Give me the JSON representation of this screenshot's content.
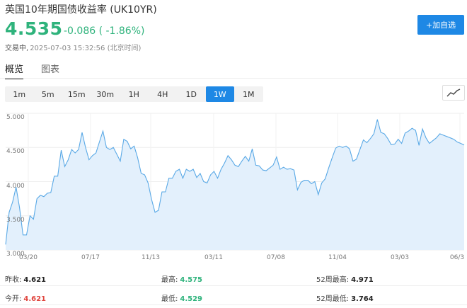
{
  "header": {
    "title": "英国10年期国债收益率 (UK10YR)",
    "price": "4.535",
    "change": "-0.086 ( -1.86%)",
    "status": "交易中,",
    "timestamp": "2025-07-03 15:32:56 (北京时间)",
    "add_watchlist": "+加自选"
  },
  "tabs": [
    {
      "label": "概览",
      "active": true
    },
    {
      "label": "图表",
      "active": false
    }
  ],
  "ranges": [
    {
      "label": "1m",
      "active": false
    },
    {
      "label": "5m",
      "active": false
    },
    {
      "label": "15m",
      "active": false
    },
    {
      "label": "30m",
      "active": false
    },
    {
      "label": "1H",
      "active": false
    },
    {
      "label": "4H",
      "active": false
    },
    {
      "label": "1D",
      "active": false
    },
    {
      "label": "1W",
      "active": true
    },
    {
      "label": "1M",
      "active": false
    }
  ],
  "chart_type_icon": "line-chart-icon",
  "chart_data": {
    "type": "area",
    "y_ticks": [
      "5.000",
      "4.500",
      "4.000",
      "3.500",
      "3.000"
    ],
    "ylim": [
      3.0,
      5.0
    ],
    "x_labels": [
      "03/20",
      "07/17",
      "11/13",
      "03/11",
      "07/08",
      "11/04",
      "03/03",
      "06/3"
    ],
    "grid": true,
    "line_color": "#5aa9e6",
    "fill_color": "#e3f0fc",
    "values": [
      3.08,
      3.55,
      3.7,
      3.92,
      3.62,
      3.22,
      3.22,
      3.5,
      3.45,
      3.75,
      3.8,
      3.78,
      3.83,
      3.84,
      4.08,
      4.08,
      4.46,
      4.22,
      4.32,
      4.47,
      4.42,
      4.47,
      4.72,
      4.5,
      4.32,
      4.38,
      4.42,
      4.58,
      4.74,
      4.5,
      4.47,
      4.5,
      4.4,
      4.3,
      4.62,
      4.59,
      4.48,
      4.52,
      4.35,
      4.12,
      4.1,
      3.98,
      3.74,
      3.55,
      3.58,
      3.85,
      3.85,
      4.05,
      4.05,
      4.15,
      4.18,
      4.05,
      4.18,
      4.15,
      4.18,
      4.06,
      4.12,
      4.0,
      3.98,
      4.1,
      4.15,
      4.05,
      4.18,
      4.27,
      4.38,
      4.32,
      4.24,
      4.22,
      4.3,
      4.37,
      4.3,
      4.48,
      4.24,
      4.23,
      4.17,
      4.16,
      4.2,
      4.24,
      4.36,
      4.18,
      4.21,
      4.18,
      4.19,
      4.17,
      3.88,
      3.99,
      4.02,
      4.02,
      3.97,
      4.0,
      3.81,
      3.98,
      4.04,
      4.2,
      4.35,
      4.49,
      4.52,
      4.5,
      4.52,
      4.48,
      4.3,
      4.33,
      4.47,
      4.61,
      4.57,
      4.63,
      4.7,
      4.91,
      4.72,
      4.7,
      4.63,
      4.54,
      4.55,
      4.62,
      4.56,
      4.71,
      4.74,
      4.78,
      4.75,
      4.53,
      4.77,
      4.64,
      4.56,
      4.6,
      4.64,
      4.7,
      4.68,
      4.66,
      4.64,
      4.62,
      4.58,
      4.56,
      4.535
    ]
  },
  "stats": {
    "prev_close_label": "昨收:",
    "prev_close": "4.621",
    "high_label": "最高:",
    "high": "4.575",
    "high52_label": "52周最高:",
    "high52": "4.971",
    "open_label": "今开:",
    "open": "4.621",
    "low_label": "最低:",
    "low": "4.529",
    "low52_label": "52周最低:",
    "low52": "3.764"
  }
}
